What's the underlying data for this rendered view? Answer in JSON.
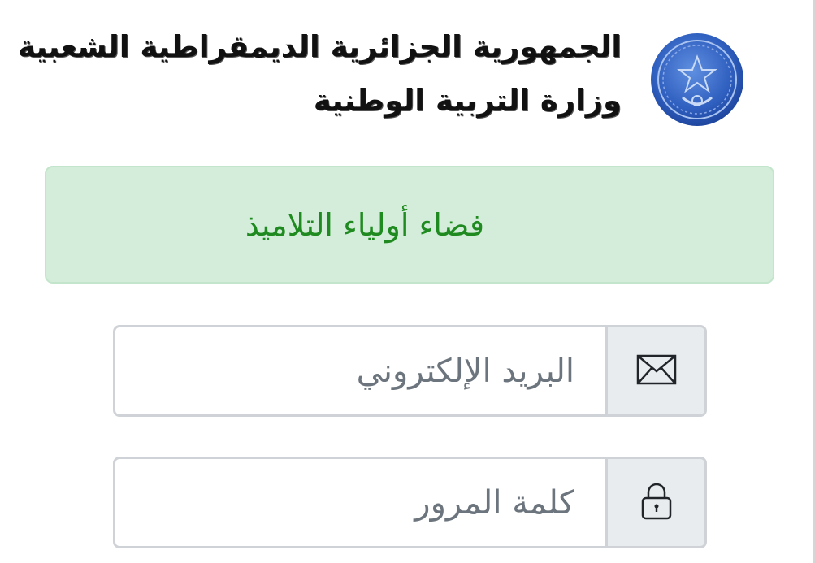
{
  "header": {
    "line1": "الجمهورية الجزائرية الديمقراطية الشعبية",
    "line2": "وزارة التربية الوطنية",
    "emblem_icon": "algeria-emblem-icon"
  },
  "alert": {
    "text": "فضاء أولياء التلاميذ",
    "background": "#d4eddb",
    "text_color": "#1f8a1f"
  },
  "form": {
    "email": {
      "value": "",
      "placeholder": "البريد الإلكتروني",
      "icon": "envelope-icon"
    },
    "password": {
      "value": "",
      "placeholder": "كلمة المرور",
      "icon": "lock-icon"
    }
  }
}
